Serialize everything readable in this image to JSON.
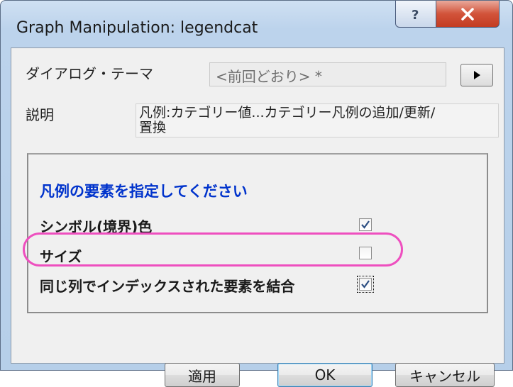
{
  "window": {
    "title": "Graph Manipulation: legendcat"
  },
  "dialog_theme": {
    "label": "ダイアログ・テーマ",
    "value": "<前回どおり> *"
  },
  "description": {
    "label": "説明",
    "line1": "凡例:カテゴリー値...カテゴリー凡例の追加/更新/",
    "line2": "置換"
  },
  "group": {
    "title": "凡例の要素を指定してください",
    "options": [
      {
        "label": "シンボル(境界)色",
        "checked": true
      },
      {
        "label": "サイズ",
        "checked": false
      },
      {
        "label": "同じ列でインデックスされた要素を結合",
        "checked": true
      }
    ]
  },
  "buttons": {
    "apply": "適用",
    "ok": "OK",
    "cancel": "キャンセル"
  },
  "icons": {
    "help": "help-icon",
    "close": "close-icon",
    "arrow": "play-arrow-icon",
    "check": "check-icon"
  },
  "colors": {
    "group_title": "#0033cc",
    "highlight": "#ee4fbf",
    "close_button": "#c33c22"
  }
}
